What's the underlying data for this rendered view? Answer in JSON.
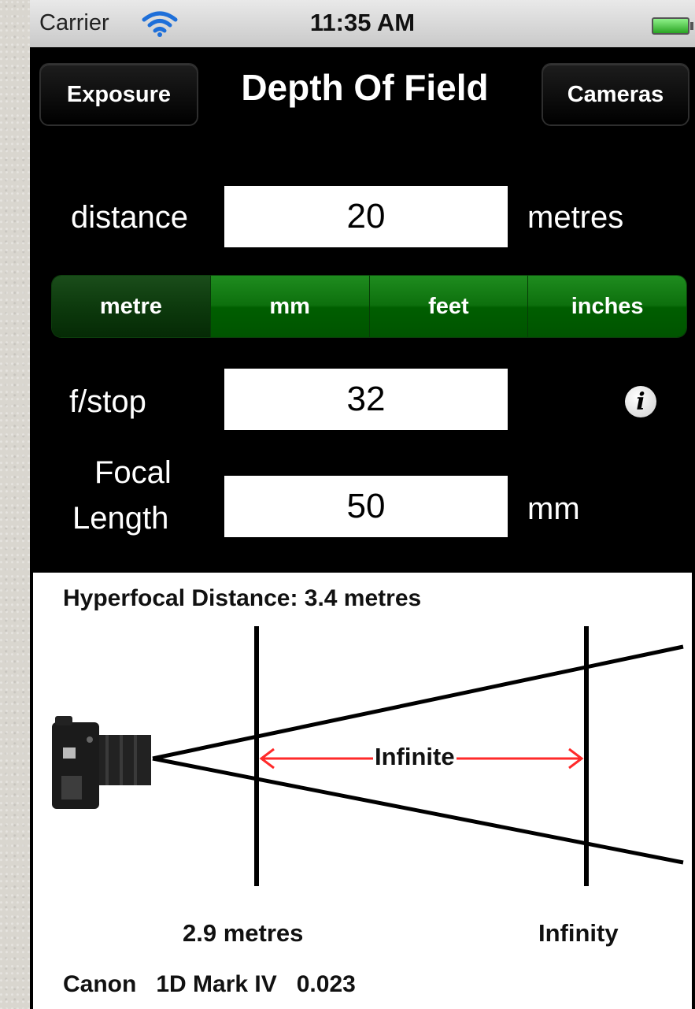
{
  "status_bar": {
    "carrier": "Carrier",
    "time": "11:35 AM"
  },
  "nav": {
    "left_button": "Exposure",
    "title": "Depth Of Field",
    "right_button": "Cameras"
  },
  "distance": {
    "label": "distance",
    "value": "20",
    "unit": "metres"
  },
  "unit_segments": {
    "options": [
      "metre",
      "mm",
      "feet",
      "inches"
    ],
    "selected": "metre"
  },
  "fstop": {
    "label": "f/stop",
    "value": "32"
  },
  "focal_length": {
    "label_line1": "Focal",
    "label_line2": "Length",
    "value": "50",
    "unit": "mm"
  },
  "diagram": {
    "hyperfocal": "Hyperfocal Distance: 3.4 metres",
    "range_label": "Infinite",
    "near_limit": "2.9 metres",
    "far_limit": "Infinity",
    "camera": "Canon   1D Mark IV   0.023"
  },
  "colors": {
    "segment_green": "#0d700d",
    "arrow_red": "#ff2a2a"
  },
  "icons": {
    "wifi": "wifi-icon",
    "battery": "battery-icon",
    "info": "info-icon",
    "camera": "camera-icon"
  }
}
